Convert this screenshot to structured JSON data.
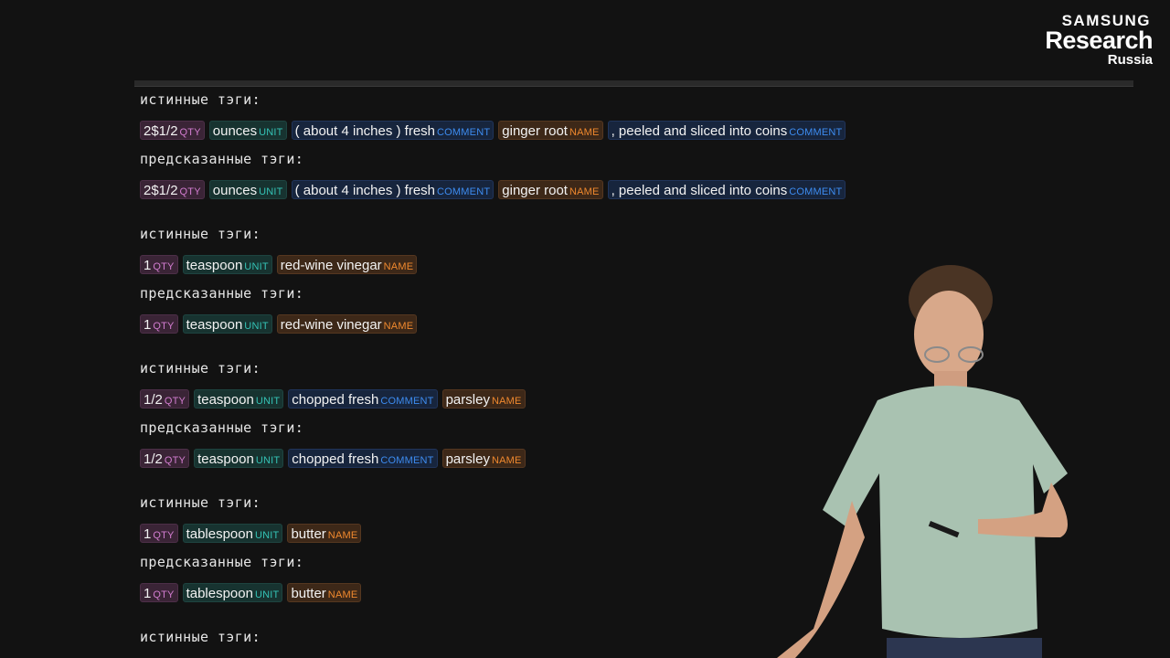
{
  "logo": {
    "line1": "SAMSUNG",
    "line2": "Research",
    "line3": "Russia"
  },
  "labels": {
    "true_tags": "истинные тэги:",
    "predicted_tags": "предсказанные тэги:"
  },
  "tag_names": {
    "qty": "QTY",
    "unit": "UNIT",
    "comment": "COMMENT",
    "name": "NAME"
  },
  "examples": [
    {
      "true": [
        {
          "text": "2$1/2",
          "tag": "QTY"
        },
        {
          "text": "ounces",
          "tag": "UNIT"
        },
        {
          "text": "( about 4 inches ) fresh",
          "tag": "COMMENT"
        },
        {
          "text": "ginger root",
          "tag": "NAME"
        },
        {
          "text": ", peeled and sliced into coins",
          "tag": "COMMENT"
        }
      ],
      "predicted": [
        {
          "text": "2$1/2",
          "tag": "QTY"
        },
        {
          "text": "ounces",
          "tag": "UNIT"
        },
        {
          "text": "( about 4 inches ) fresh",
          "tag": "COMMENT"
        },
        {
          "text": "ginger root",
          "tag": "NAME"
        },
        {
          "text": ", peeled and sliced into coins",
          "tag": "COMMENT"
        }
      ]
    },
    {
      "true": [
        {
          "text": "1",
          "tag": "QTY"
        },
        {
          "text": "teaspoon",
          "tag": "UNIT"
        },
        {
          "text": "red-wine vinegar",
          "tag": "NAME"
        }
      ],
      "predicted": [
        {
          "text": "1",
          "tag": "QTY"
        },
        {
          "text": "teaspoon",
          "tag": "UNIT"
        },
        {
          "text": "red-wine vinegar",
          "tag": "NAME"
        }
      ]
    },
    {
      "true": [
        {
          "text": "1/2",
          "tag": "QTY"
        },
        {
          "text": "teaspoon",
          "tag": "UNIT"
        },
        {
          "text": "chopped fresh",
          "tag": "COMMENT"
        },
        {
          "text": "parsley",
          "tag": "NAME"
        }
      ],
      "predicted": [
        {
          "text": "1/2",
          "tag": "QTY"
        },
        {
          "text": "teaspoon",
          "tag": "UNIT"
        },
        {
          "text": "chopped fresh",
          "tag": "COMMENT"
        },
        {
          "text": "parsley",
          "tag": "NAME"
        }
      ]
    },
    {
      "true": [
        {
          "text": "1",
          "tag": "QTY"
        },
        {
          "text": "tablespoon",
          "tag": "UNIT"
        },
        {
          "text": "butter",
          "tag": "NAME"
        }
      ],
      "predicted": [
        {
          "text": "1",
          "tag": "QTY"
        },
        {
          "text": "tablespoon",
          "tag": "UNIT"
        },
        {
          "text": "butter",
          "tag": "NAME"
        }
      ]
    },
    {
      "true": [],
      "predicted": null
    }
  ],
  "colors": {
    "background": "#121212",
    "qty_tag": "#d27dd0",
    "unit_tag": "#34c2b5",
    "comment_tag": "#3d8cf0",
    "name_tag": "#f0892e"
  },
  "presenter": {
    "icon": "person-presenter-icon"
  }
}
